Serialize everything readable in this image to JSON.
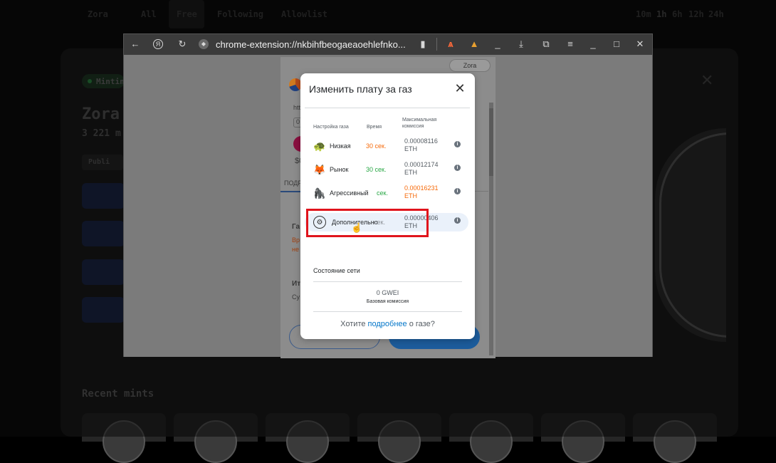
{
  "background": {
    "nav": [
      "Zora",
      "All",
      "Free",
      "Following",
      "Allowlist"
    ],
    "time_filters": [
      "10m",
      "1h",
      "6h",
      "12h",
      "24h"
    ],
    "minting_badge": "Mintin",
    "title": "Zora",
    "subtitle": "3 221 m",
    "public_tag": "Publi",
    "recent_mints": "Recent mints"
  },
  "browser": {
    "url": "chrome-extension://nkbihfbeogaeaoehlefnko...",
    "colors": {
      "toolbar": "#3b3b3b",
      "accent": "#e0141c"
    }
  },
  "metamask": {
    "network": "Zora",
    "frag_http": "htt",
    "frag_zero": "0",
    "frag_dollar": "$0",
    "tab_label": "ПОДР",
    "frag_gas": "Га:",
    "frag_warn1": "Вр",
    "frag_warn2": "не",
    "frag_total": "Ит",
    "frag_sum": "Су"
  },
  "modal": {
    "title": "Изменить плату за газ",
    "col_setting": "Настройка газа",
    "col_time": "Время",
    "col_fee": "Максимальная комиссия",
    "rows": [
      {
        "name": "Низкая",
        "time": "30 сек.",
        "time_color": "#f66a0a",
        "fee": "0.00008116",
        "unit": "ETH",
        "fee_color": "#535a61",
        "icon": "turtle-icon"
      },
      {
        "name": "Рынок",
        "time": "30 сек.",
        "time_color": "#28a745",
        "fee": "0.00012174",
        "unit": "ETH",
        "fee_color": "#535a61",
        "icon": "fox-icon"
      },
      {
        "name": "Агрессивный",
        "time": "сек.",
        "time_color": "#28a745",
        "fee": "0.00016231",
        "unit": "ETH",
        "fee_color": "#f66a0a",
        "icon": "gorilla-icon"
      },
      {
        "name": "Дополнительно",
        "time": "сек.",
        "time_color": "#535a61",
        "fee": "0.00000406",
        "unit": "ETH",
        "fee_color": "#535a61",
        "icon": "gear-icon"
      }
    ],
    "network_status": "Состояние сети",
    "gwei": "0 GWEI",
    "base_fee": "Базовая комиссия",
    "footer_prefix": "Хотите ",
    "footer_link": "подробнее",
    "footer_suffix": " о газе?"
  }
}
